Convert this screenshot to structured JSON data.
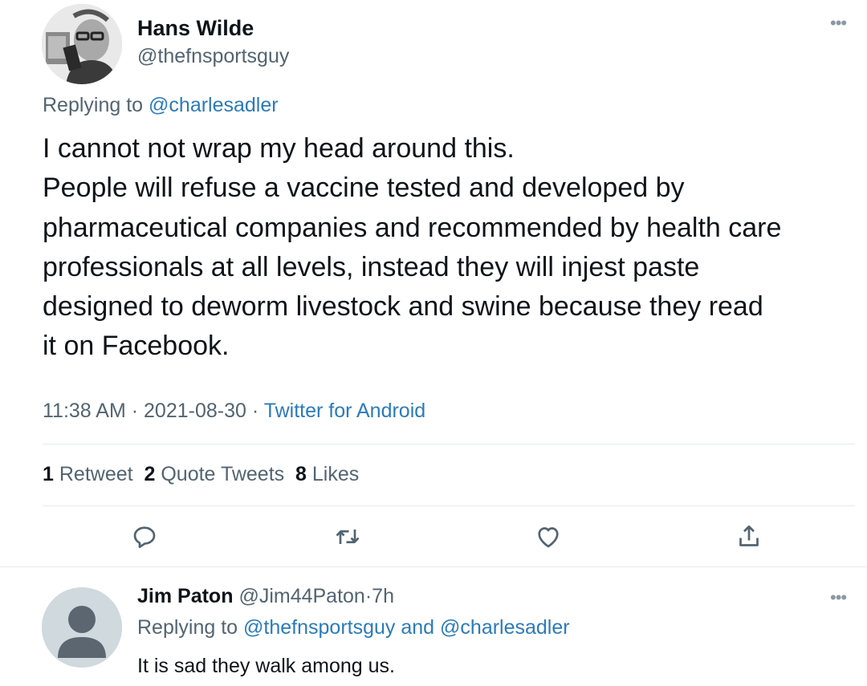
{
  "tweet": {
    "author_name": "Hans Wilde",
    "author_handle": "@thefnsportsguy",
    "replying_prefix": "Replying to",
    "replying_to": "@charlesadler",
    "text_lines": [
      "I cannot not wrap my head around this.",
      "People will refuse a vaccine tested and developed by",
      "pharmaceutical companies and recommended by health care",
      "professionals at all levels, instead they will injest paste",
      "designed to deworm livestock and swine because they read",
      "it on Facebook."
    ],
    "time": "11:38 AM",
    "date": "2021-08-30",
    "separator": "·",
    "source": "Twitter for Android",
    "stats": {
      "retweets_count": "1",
      "retweets_label": "Retweet",
      "quotes_count": "2",
      "quotes_label": "Quote Tweets",
      "likes_count": "8",
      "likes_label": "Likes"
    },
    "more_icon": "more-horizontal-icon"
  },
  "actions": {
    "reply_icon": "reply-icon",
    "retweet_icon": "retweet-icon",
    "like_icon": "heart-icon",
    "share_icon": "share-icon"
  },
  "reply": {
    "author_name": "Jim Paton",
    "author_handle": "@Jim44Paton",
    "separator": "·",
    "age": "7h",
    "replying_prefix": "Replying to",
    "replying_to_1": "@thefnsportsguy",
    "and_word": "and",
    "replying_to_2": "@charlesadler",
    "text": "It is sad they walk among us.",
    "more_icon": "more-horizontal-icon"
  },
  "colors": {
    "text": "#0f1419",
    "secondary": "#536471",
    "link": "#2b7bb9",
    "divider": "#e6ecf0"
  }
}
